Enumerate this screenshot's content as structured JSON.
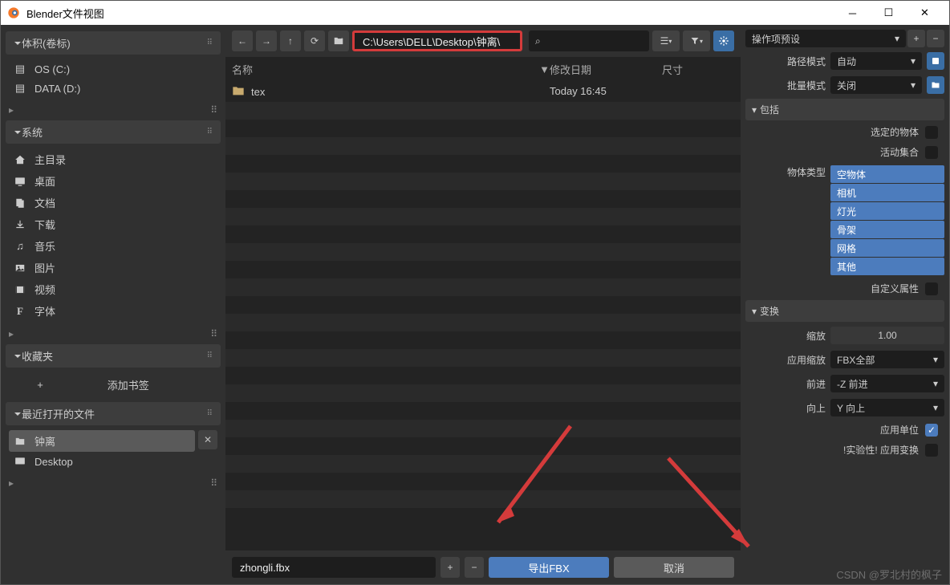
{
  "window": {
    "title": "Blender文件视图"
  },
  "volumes": {
    "header": "体积(卷标)",
    "items": [
      "OS (C:)",
      "DATA (D:)"
    ]
  },
  "system": {
    "header": "系统",
    "items": [
      "主目录",
      "桌面",
      "文档",
      "下载",
      "音乐",
      "图片",
      "视频",
      "字体"
    ]
  },
  "favorites": {
    "header": "收藏夹",
    "add": "添加书签"
  },
  "recent": {
    "header": "最近打开的文件",
    "items": [
      "钟离",
      "Desktop"
    ]
  },
  "path": "C:\\Users\\DELL\\Desktop\\钟离\\",
  "columns": {
    "name": "名称",
    "date": "修改日期",
    "size": "尺寸"
  },
  "files": [
    {
      "name": "tex",
      "date": "Today 16:45",
      "size": ""
    }
  ],
  "filename": "zhongli.fbx",
  "actions": {
    "export": "导出FBX",
    "cancel": "取消"
  },
  "options": {
    "preset": "操作项预设",
    "path_mode": {
      "label": "路径模式",
      "value": "自动"
    },
    "batch_mode": {
      "label": "批量模式",
      "value": "关闭"
    },
    "include": {
      "header": "包括",
      "selected_objects": "选定的物体",
      "active_collection": "活动集合",
      "object_types_label": "物体类型",
      "object_types": [
        "空物体",
        "相机",
        "灯光",
        "骨架",
        "网格",
        "其他"
      ],
      "custom_props": "自定义属性"
    },
    "transform": {
      "header": "变换",
      "scale": {
        "label": "缩放",
        "value": "1.00"
      },
      "apply_scale": {
        "label": "应用缩放",
        "value": "FBX全部"
      },
      "forward": {
        "label": "前进",
        "value": "-Z 前进"
      },
      "up": {
        "label": "向上",
        "value": "Y 向上"
      },
      "apply_unit": "应用单位",
      "experimental": "!实验性! 应用变换"
    }
  },
  "watermark": "CSDN @罗北村的枫子"
}
